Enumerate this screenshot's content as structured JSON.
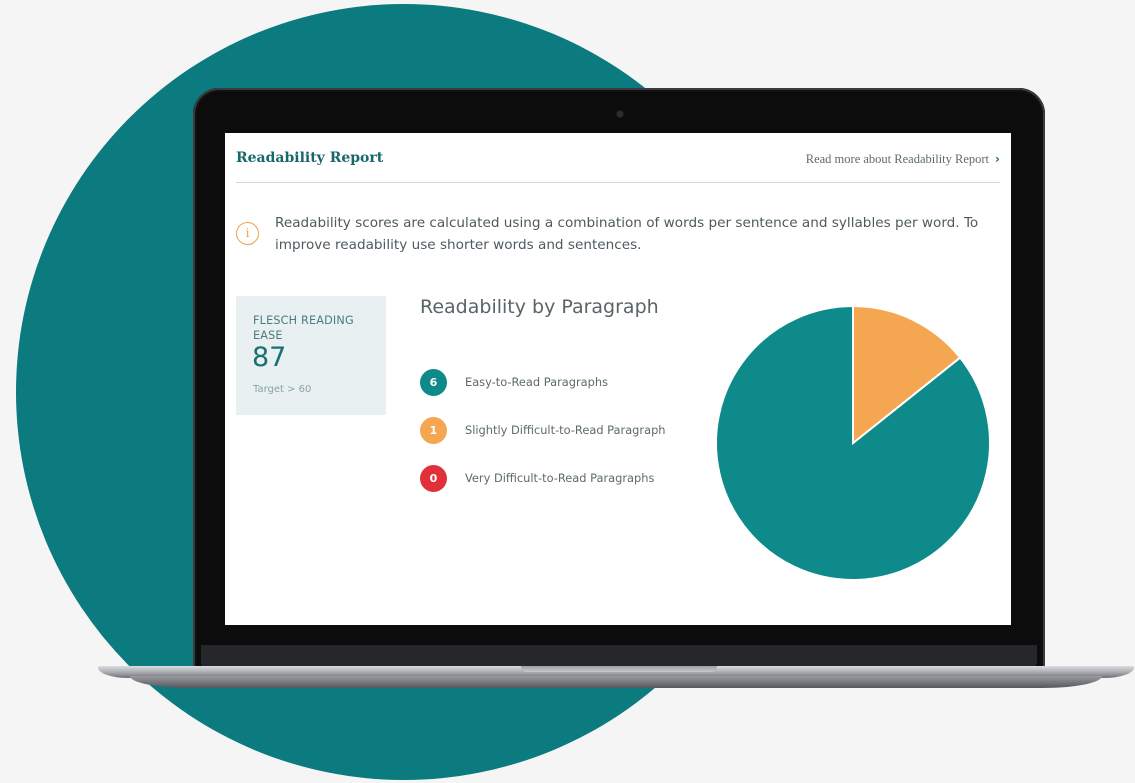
{
  "report": {
    "title": "Readability Report",
    "read_more_label": "Read more about Readability Report",
    "info_text": "Readability scores are calculated using a combination of words per sentence and syllables per word. To improve readability use shorter words and sentences."
  },
  "score": {
    "label": "FLESCH READING EASE",
    "value": "87",
    "target": "Target > 60"
  },
  "section_title": "Readability by Paragraph",
  "colors": {
    "teal": "#0e8a8a",
    "orange": "#f5a651",
    "red": "#e0303a"
  },
  "legend": [
    {
      "count": "6",
      "label": "Easy-to-Read Paragraphs",
      "color": "#0e8a8a"
    },
    {
      "count": "1",
      "label": "Slightly Difficult-to-Read Paragraph",
      "color": "#f5a651"
    },
    {
      "count": "0",
      "label": "Very Difficult-to-Read Paragraphs",
      "color": "#e0303a"
    }
  ],
  "chart_data": {
    "type": "pie",
    "labels": [
      "Easy-to-Read Paragraphs",
      "Slightly Difficult-to-Read Paragraph",
      "Very Difficult-to-Read Paragraphs"
    ],
    "values": [
      6,
      1,
      0
    ],
    "colors": [
      "#0e8a8a",
      "#f5a651",
      "#e0303a"
    ]
  }
}
